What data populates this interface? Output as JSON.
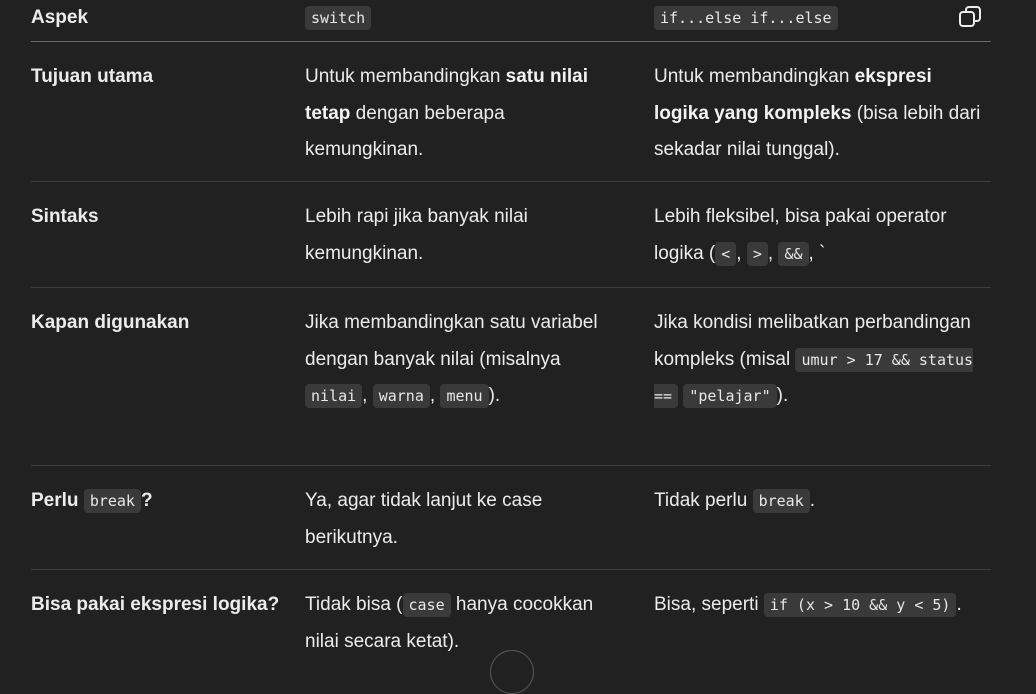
{
  "header": {
    "col1": "Aspek",
    "col2": "switch",
    "col3": "if...else if...else"
  },
  "rows": [
    {
      "aspect": "Tujuan utama",
      "switch": [
        "Untuk membandingkan ",
        "satu nilai tetap",
        " dengan beberapa kemungkinan."
      ],
      "ifelse": [
        "Untuk membandingkan ",
        "ekspresi logika yang kompleks",
        " (bisa lebih dari sekadar nilai tunggal)."
      ]
    },
    {
      "aspect": "Sintaks",
      "switch": "Lebih rapi jika banyak nilai kemungkinan.",
      "ifelse": {
        "pre": "Lebih fleksibel, bisa pakai operator logika (",
        "ops": [
          "<",
          ">",
          "&&"
        ],
        "sep": ", ",
        "post": ", `"
      }
    },
    {
      "aspect": "Kapan digunakan",
      "switch": {
        "pre": "Jika membandingkan satu variabel dengan banyak nilai (misalnya ",
        "vals": [
          "nilai",
          "warna",
          "menu"
        ],
        "sep": ", ",
        "post": ")."
      },
      "ifelse": {
        "pre": "Jika kondisi melibatkan perbandingan kompleks (misal ",
        "code_a": "umur > 17 && status ==",
        "code_b": "\"pelajar\"",
        "post": ")."
      }
    },
    {
      "aspect_pre": "Perlu ",
      "aspect_code": "break",
      "aspect_post": "?",
      "switch": "Ya, agar tidak lanjut ke case berikutnya.",
      "ifelse_pre": "Tidak perlu ",
      "ifelse_code": "break",
      "ifelse_post": "."
    },
    {
      "aspect": "Bisa pakai ekspresi logika?",
      "switch_pre": "Tidak bisa (",
      "switch_code": "case",
      "switch_post": " hanya cocokkan nilai secara ketat).",
      "ifelse_pre": "Bisa, seperti ",
      "ifelse_code": "if (x > 10 && y < 5)",
      "ifelse_post": "."
    }
  ],
  "icons": {
    "copy": "copy-icon",
    "scroll": "scroll-down-button"
  }
}
